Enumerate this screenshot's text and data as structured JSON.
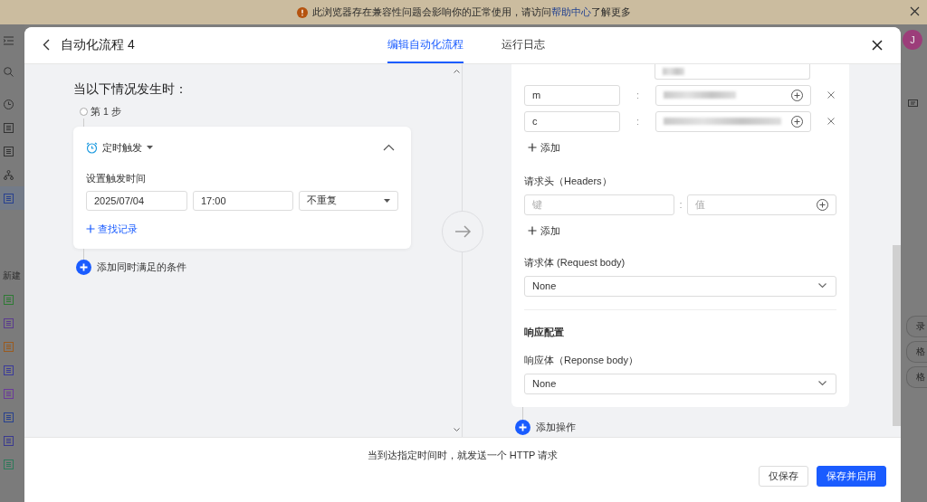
{
  "banner": {
    "text_before": "此浏览器存在兼容性问题会影响你的正常使用，请访问",
    "link": "帮助中心",
    "text_after": "了解更多"
  },
  "background": {
    "new_label": "新建",
    "avatar": "J",
    "side_buttons": [
      "录",
      "格",
      "格"
    ]
  },
  "dialog": {
    "title": "自动化流程 4",
    "tabs": [
      {
        "label": "编辑自动化流程",
        "selected": true
      },
      {
        "label": "运行日志",
        "selected": false
      }
    ],
    "trigger": {
      "heading": "当以下情况发生时：",
      "step": "第 1 步",
      "type": "定时触发",
      "expanded": true,
      "time_label": "设置触发时间",
      "date": "2025/07/04",
      "time": "17:00",
      "repeat": "不重复",
      "find_link": "查找记录",
      "add_condition": "添加同时满足的条件"
    },
    "action": {
      "params": [
        {
          "key": "m",
          "separator": ":"
        },
        {
          "key": "c",
          "separator": ":"
        }
      ],
      "add_param": "添加",
      "headers_label": "请求头（Headers）",
      "header_key_placeholder": "键",
      "header_separator": ":",
      "header_value_placeholder": "值",
      "add_header": "添加",
      "request_body_label": "请求体 (Request body)",
      "request_body": "None",
      "response_heading": "响应配置",
      "response_body_label": "响应体（Reponse body）",
      "response_body": "None",
      "add_action": "添加操作"
    },
    "footer": {
      "summary": "当到达指定时间时，就发送一个 HTTP 请求",
      "buttons": [
        {
          "label": "仅保存",
          "kind": "secondary"
        },
        {
          "label": "保存并启用",
          "kind": "primary"
        }
      ]
    }
  }
}
